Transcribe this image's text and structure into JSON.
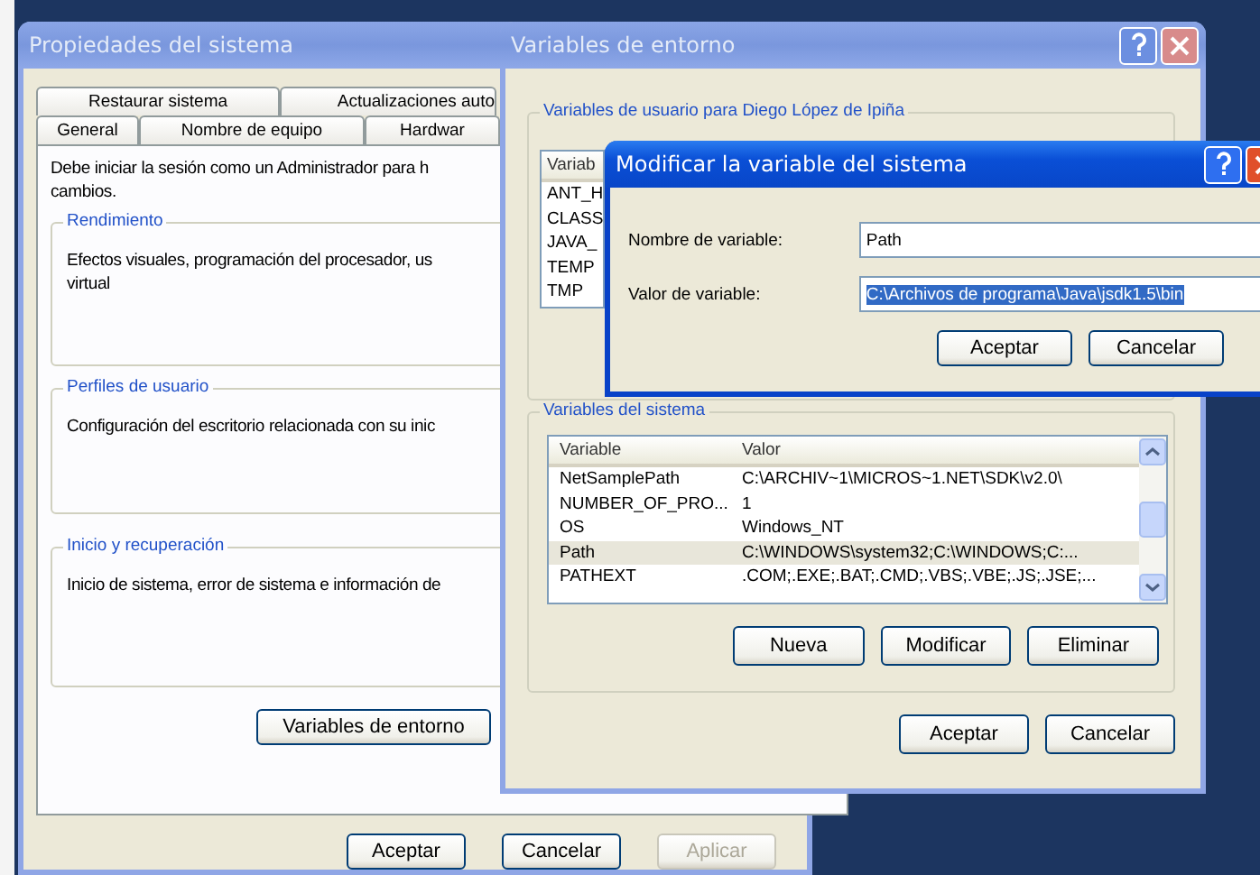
{
  "system_properties": {
    "title": "Propiedades del sistema",
    "active": false,
    "tab_rows": [
      [
        {
          "label": "Restaurar sistema",
          "selected": false
        },
        {
          "label": "Actualizaciones auto",
          "selected": false
        }
      ],
      [
        {
          "label": "General",
          "selected": false
        },
        {
          "label": "Nombre de equipo",
          "selected": false
        },
        {
          "label": "Hardwar",
          "selected": false
        }
      ]
    ],
    "notice_lines": [
      "Debe iniciar la sesión como un Administrador para h",
      "cambios."
    ],
    "groups": [
      {
        "title": "Rendimiento",
        "lines": [
          "Efectos visuales, programación del procesador, us",
          "virtual"
        ]
      },
      {
        "title": "Perfiles de usuario",
        "lines": [
          "Configuración del escritorio relacionada con su inic"
        ]
      },
      {
        "title": "Inicio y recuperación",
        "lines": [
          "Inicio de sistema, error de sistema e información de"
        ]
      }
    ],
    "env_button": "Variables de entorno",
    "buttons": [
      {
        "label": "Aceptar",
        "disabled": false
      },
      {
        "label": "Cancelar",
        "disabled": false
      },
      {
        "label": "Aplicar",
        "disabled": true
      }
    ]
  },
  "environment_variables": {
    "title": "Variables de entorno",
    "active": false,
    "user_group": {
      "title": "Variables de usuario para Diego López de Ipiña",
      "column": "Variab",
      "rows": [
        "ANT_H",
        "CLASS",
        "JAVA_",
        "TEMP",
        "TMP"
      ]
    },
    "system_group": {
      "title": "Variables del sistema",
      "columns": [
        "Variable",
        "Valor"
      ],
      "rows": [
        {
          "variable": "NetSamplePath",
          "value": "C:\\ARCHIV~1\\MICROS~1.NET\\SDK\\v2.0\\",
          "selected": false
        },
        {
          "variable": "NUMBER_OF_PRO...",
          "value": "1",
          "selected": false
        },
        {
          "variable": "OS",
          "value": "Windows_NT",
          "selected": false
        },
        {
          "variable": "Path",
          "value": "C:\\WINDOWS\\system32;C:\\WINDOWS;C:...",
          "selected": true
        },
        {
          "variable": "PATHEXT",
          "value": ".COM;.EXE;.BAT;.CMD;.VBS;.VBE;.JS;.JSE;...",
          "selected": false
        }
      ],
      "buttons": [
        "Nueva",
        "Modificar",
        "Eliminar"
      ]
    },
    "buttons": [
      "Aceptar",
      "Cancelar"
    ]
  },
  "edit_dialog": {
    "title": "Modificar la variable del sistema",
    "active": true,
    "fields": [
      {
        "label": "Nombre de variable:",
        "value": "Path",
        "selected": false
      },
      {
        "label": "Valor de variable:",
        "value": "C:\\Archivos de programa\\Java\\jsdk1.5\\bin",
        "selected": true
      }
    ],
    "buttons": [
      "Aceptar",
      "Cancelar"
    ]
  }
}
